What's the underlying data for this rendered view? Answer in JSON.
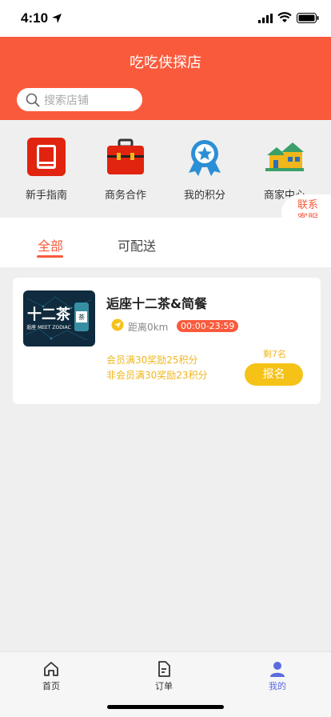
{
  "status_bar": {
    "time": "4:10"
  },
  "header": {
    "title": "吃吃侠探店"
  },
  "search": {
    "placeholder": "搜索店铺"
  },
  "menu": [
    {
      "label": "新手指南",
      "icon": "book-icon"
    },
    {
      "label": "商务合作",
      "icon": "briefcase-icon"
    },
    {
      "label": "我的积分",
      "icon": "badge-star-icon"
    },
    {
      "label": "商家中心",
      "icon": "houses-icon"
    }
  ],
  "customer_service": {
    "line1": "联系",
    "line2": "客服"
  },
  "tabs": [
    {
      "label": "全部",
      "active": true
    },
    {
      "label": "可配送",
      "active": false
    }
  ],
  "shop": {
    "name": "逅座十二茶&简餐",
    "image_text": "十二茶",
    "image_subtext": "逅座 MEET ZODIAC",
    "distance": "距离0km",
    "hours": "00:00-23:59",
    "reward_member": "会员满30奖励25积分",
    "reward_nonmember": "非会员满30奖励23积分",
    "remaining": "剩7名",
    "signup": "报名"
  },
  "tabbar": [
    {
      "label": "首页",
      "icon": "home-icon",
      "active": false
    },
    {
      "label": "订单",
      "icon": "order-icon",
      "active": false
    },
    {
      "label": "我的",
      "icon": "user-icon",
      "active": true
    }
  ],
  "colors": {
    "brand": "#fa5a3c",
    "accent_yellow": "#f5c218",
    "active_tab": "#5b6be0"
  }
}
